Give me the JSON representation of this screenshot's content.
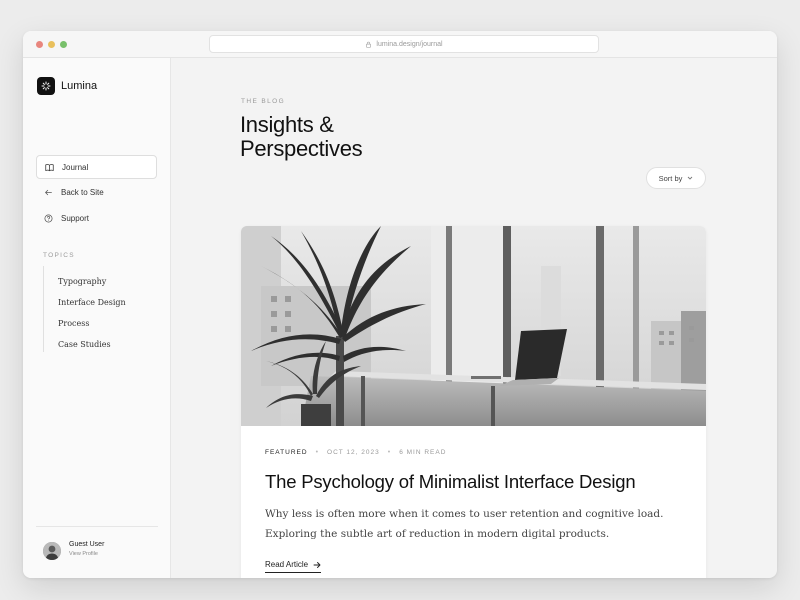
{
  "browser": {
    "url": "lumina.design/journal"
  },
  "brand": {
    "name": "Lumina",
    "logo_icon": "sparkle-icon"
  },
  "nav": [
    {
      "label": "Journal",
      "icon": "book-open-icon",
      "active": true
    },
    {
      "label": "Back to Site",
      "icon": "arrow-left-icon",
      "active": false
    },
    {
      "label": "Support",
      "icon": "help-circle-icon",
      "active": false
    }
  ],
  "topics": {
    "heading": "TOPICS",
    "items": [
      "Typography",
      "Interface Design",
      "Process",
      "Case Studies"
    ]
  },
  "profile": {
    "name": "Guest User",
    "subtitle": "View Profile"
  },
  "main": {
    "eyebrow": "THE BLOG",
    "title": "Insights & Perspectives",
    "sort_label": "Sort by"
  },
  "article": {
    "tag": "FEATURED",
    "date": "OCT 12, 2023",
    "read_time": "6 MIN READ",
    "title": "The Psychology of Minimalist Interface Design",
    "excerpt": "Why less is often more when it comes to user retention and cognitive load. Exploring the subtle art of reduction in modern digital products.",
    "cta": "Read Article"
  },
  "colors": {
    "accent": "#111111",
    "background": "#f3f3f3",
    "sidebar": "#fafafa"
  }
}
